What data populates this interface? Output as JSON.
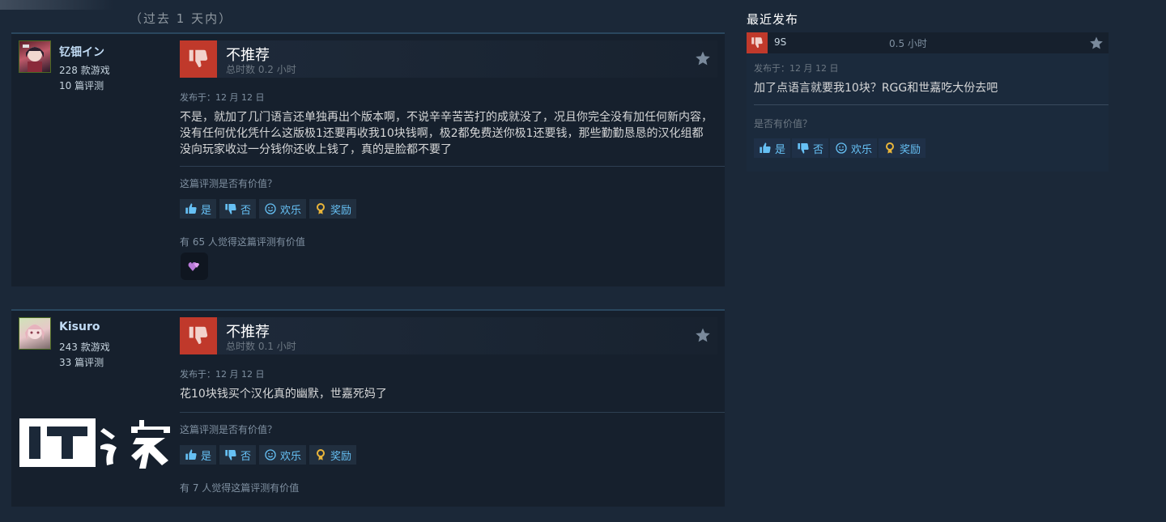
{
  "period_label": "（过去 1 天内）",
  "reviews": [
    {
      "author": {
        "name": "钇钿イン",
        "games": "228 款游戏",
        "reviews": "10 篇评测"
      },
      "verdict": "不推荐",
      "hours": "总时数 0.2 小时",
      "posted": "发布于：12 月 12 日",
      "text": "不是，就加了几门语言还单独再出个版本啊，不说辛辛苦苦打的成就没了，况且你完全没有加任何新内容，没有任何优化凭什么这版极1还要再收我10块钱啊，极2都免费送你极1还要钱，那些勤勤恳恳的汉化组都没向玩家收过一分钱你还收上钱了，真的是脸都不要了",
      "helpful_question": "这篇评测是否有价值？",
      "buttons": {
        "yes": "是",
        "no": "否",
        "funny": "欢乐",
        "award": "奖励"
      },
      "helpful_count": "有 65 人觉得这篇评测有价值"
    },
    {
      "author": {
        "name": "Kisuro",
        "games": "243 款游戏",
        "reviews": "33 篇评测"
      },
      "verdict": "不推荐",
      "hours": "总时数 0.1 小时",
      "posted": "发布于：12 月 12 日",
      "text": "花10块钱买个汉化真的幽默，世嘉死妈了",
      "helpful_question": "这篇评测是否有价值？",
      "buttons": {
        "yes": "是",
        "no": "否",
        "funny": "欢乐",
        "award": "奖励"
      },
      "helpful_count": "有 7 人觉得这篇评测有价值"
    }
  ],
  "recent": {
    "heading": "最近发布",
    "name": "9S",
    "hours": "0.5 小时",
    "posted": "发布于：12 月 12 日",
    "text": "加了点语言就要我10块？RGG和世嘉吃大份去吧",
    "helpful_question": "是否有价值？",
    "buttons": {
      "yes": "是",
      "no": "否",
      "funny": "欢乐",
      "award": "奖励"
    }
  },
  "watermark": "IT之家",
  "colors": {
    "background": "#1b2838",
    "panel": "#16202d",
    "thumbs_down": "#c0392b",
    "link": "#66c0f4"
  }
}
